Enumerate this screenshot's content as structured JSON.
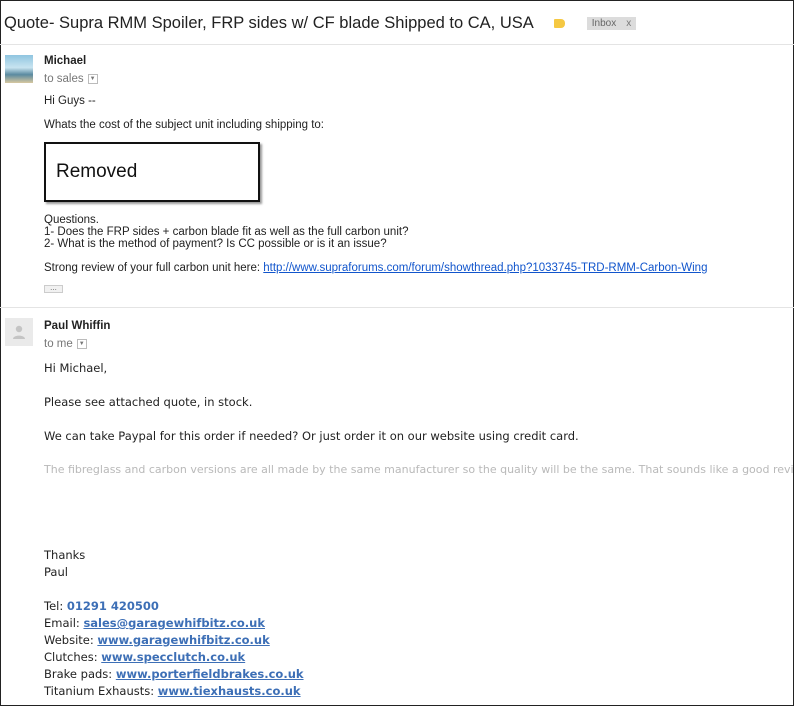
{
  "thread": {
    "subject": "Quote- Supra RMM Spoiler, FRP sides w/ CF blade Shipped to CA, USA",
    "label": "Inbox",
    "label_close": "x"
  },
  "message1": {
    "sender": "Michael",
    "to": "to sales",
    "greeting": "Hi Guys --",
    "line1": "Whats the cost of the subject unit including shipping to:",
    "removed": "Removed",
    "questions_heading": "Questions.",
    "q1": "1- Does the FRP sides + carbon blade fit as well as the full carbon unit?",
    "q2": "2- What is the method of payment? Is CC possible or is it an issue?",
    "review_text": "Strong review of your full carbon unit here: ",
    "review_link": "http://www.supraforums.com/forum/showthread.php?1033745-TRD-RMM-Carbon-Wing",
    "ellipsis": "..."
  },
  "message2": {
    "sender": "Paul Whiffin",
    "to": "to me",
    "greeting": "Hi Michael,",
    "line1": "Please see attached quote, in stock.",
    "line2": "We can take Paypal for this order if needed? Or just order it on our website using credit card.",
    "line3": "The fibreglass and carbon versions are all made by the same manufacturer so the quality will be the same. That sounds like a good review!",
    "thanks": "Thanks",
    "name": "Paul",
    "signature": {
      "tel_label": "Tel: ",
      "tel": "01291 420500",
      "email_label": "Email: ",
      "email": "sales@garagewhifbitz.co.uk",
      "website_label": "Website: ",
      "website": "www.garagewhifbitz.co.uk",
      "clutches_label": "Clutches: ",
      "clutches": "www.specclutch.co.uk",
      "brakes_label": "Brake pads: ",
      "brakes": "www.porterfieldbrakes.co.uk",
      "exhausts_label": "Titanium Exhausts: ",
      "exhausts": "www.tiexhausts.co.uk"
    }
  },
  "colors": {
    "link": "#1155cc",
    "signature_blue": "#3d6fb6",
    "label_tag": "#f5c842",
    "faded_text": "#b9b9b9"
  }
}
